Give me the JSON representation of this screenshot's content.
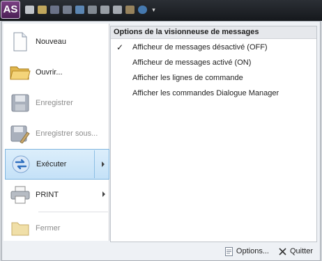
{
  "app": {
    "orb_label": "AS"
  },
  "quick_access": {
    "icons": [
      "new-file-icon",
      "open-folder-icon",
      "save-icon",
      "save-as-icon",
      "run-icon",
      "print-icon",
      "cut-icon",
      "copy-icon",
      "paste-icon",
      "web-icon",
      "customize-icon"
    ]
  },
  "commands": [
    {
      "label": "Nouveau",
      "icon": "new-document-icon",
      "enabled": true
    },
    {
      "label": "Ouvrir...",
      "icon": "open-folder-icon",
      "enabled": true
    },
    {
      "label": "Enregistrer",
      "icon": "save-icon",
      "enabled": false
    },
    {
      "label": "Enregistrer sous...",
      "icon": "save-as-icon",
      "enabled": false
    },
    {
      "label": "Exécuter",
      "icon": "run-icon",
      "enabled": true,
      "submenu": true,
      "active": true
    },
    {
      "label": "PRINT",
      "icon": "print-icon",
      "enabled": true,
      "submenu": true
    },
    {
      "label": "Fermer",
      "icon": "close-folder-icon",
      "enabled": false
    }
  ],
  "panel": {
    "title": "Options de la visionneuse de messages",
    "options": [
      {
        "label": "Afficheur de messages désactivé (OFF)",
        "checked": true
      },
      {
        "label": "Afficheur de messages activé (ON)",
        "checked": false
      },
      {
        "label": "Afficher les lignes de commande",
        "checked": false
      },
      {
        "label": "Afficher les commandes Dialogue Manager",
        "checked": false
      }
    ]
  },
  "footer": {
    "options_label": "Options...",
    "quit_label": "Quitter"
  },
  "colors": {
    "accent": "#c4e1f7",
    "title_bar": "#1e2227",
    "orb": "#5d2a69"
  }
}
